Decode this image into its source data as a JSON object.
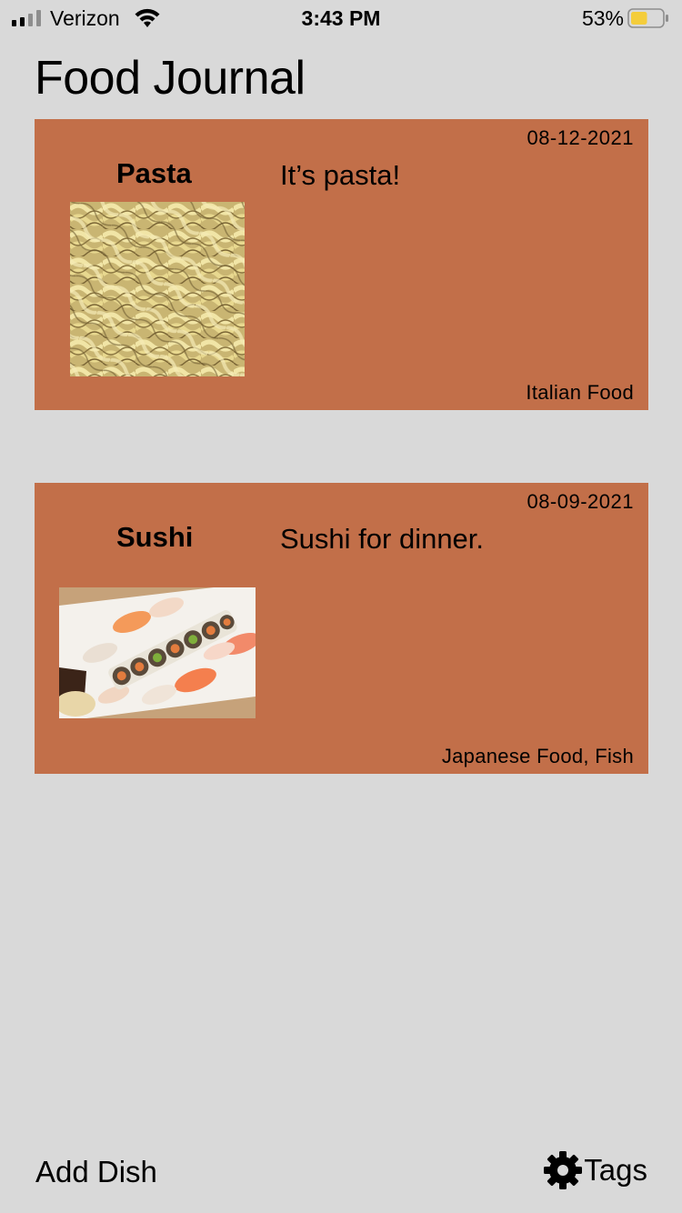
{
  "status_bar": {
    "carrier": "Verizon",
    "time": "3:43 PM",
    "battery_percent": "53%",
    "battery_level": 0.53,
    "battery_color": "#f4cd3c"
  },
  "header": {
    "title": "Food Journal"
  },
  "dishes": [
    {
      "name": "Pasta",
      "date": "08-12-2021",
      "description": "It’s pasta!",
      "tags": "Italian Food",
      "photo": "rotini-pasta-photo"
    },
    {
      "name": "Sushi",
      "date": "08-09-2021",
      "description": "Sushi for dinner.",
      "tags": "Japanese Food, Fish",
      "photo": "sushi-platter-photo"
    }
  ],
  "toolbar": {
    "add_dish_label": "Add Dish",
    "tags_label": "Tags",
    "tags_icon": "gear-icon"
  },
  "colors": {
    "background": "#d9d9d9",
    "card": "#c26f49"
  }
}
